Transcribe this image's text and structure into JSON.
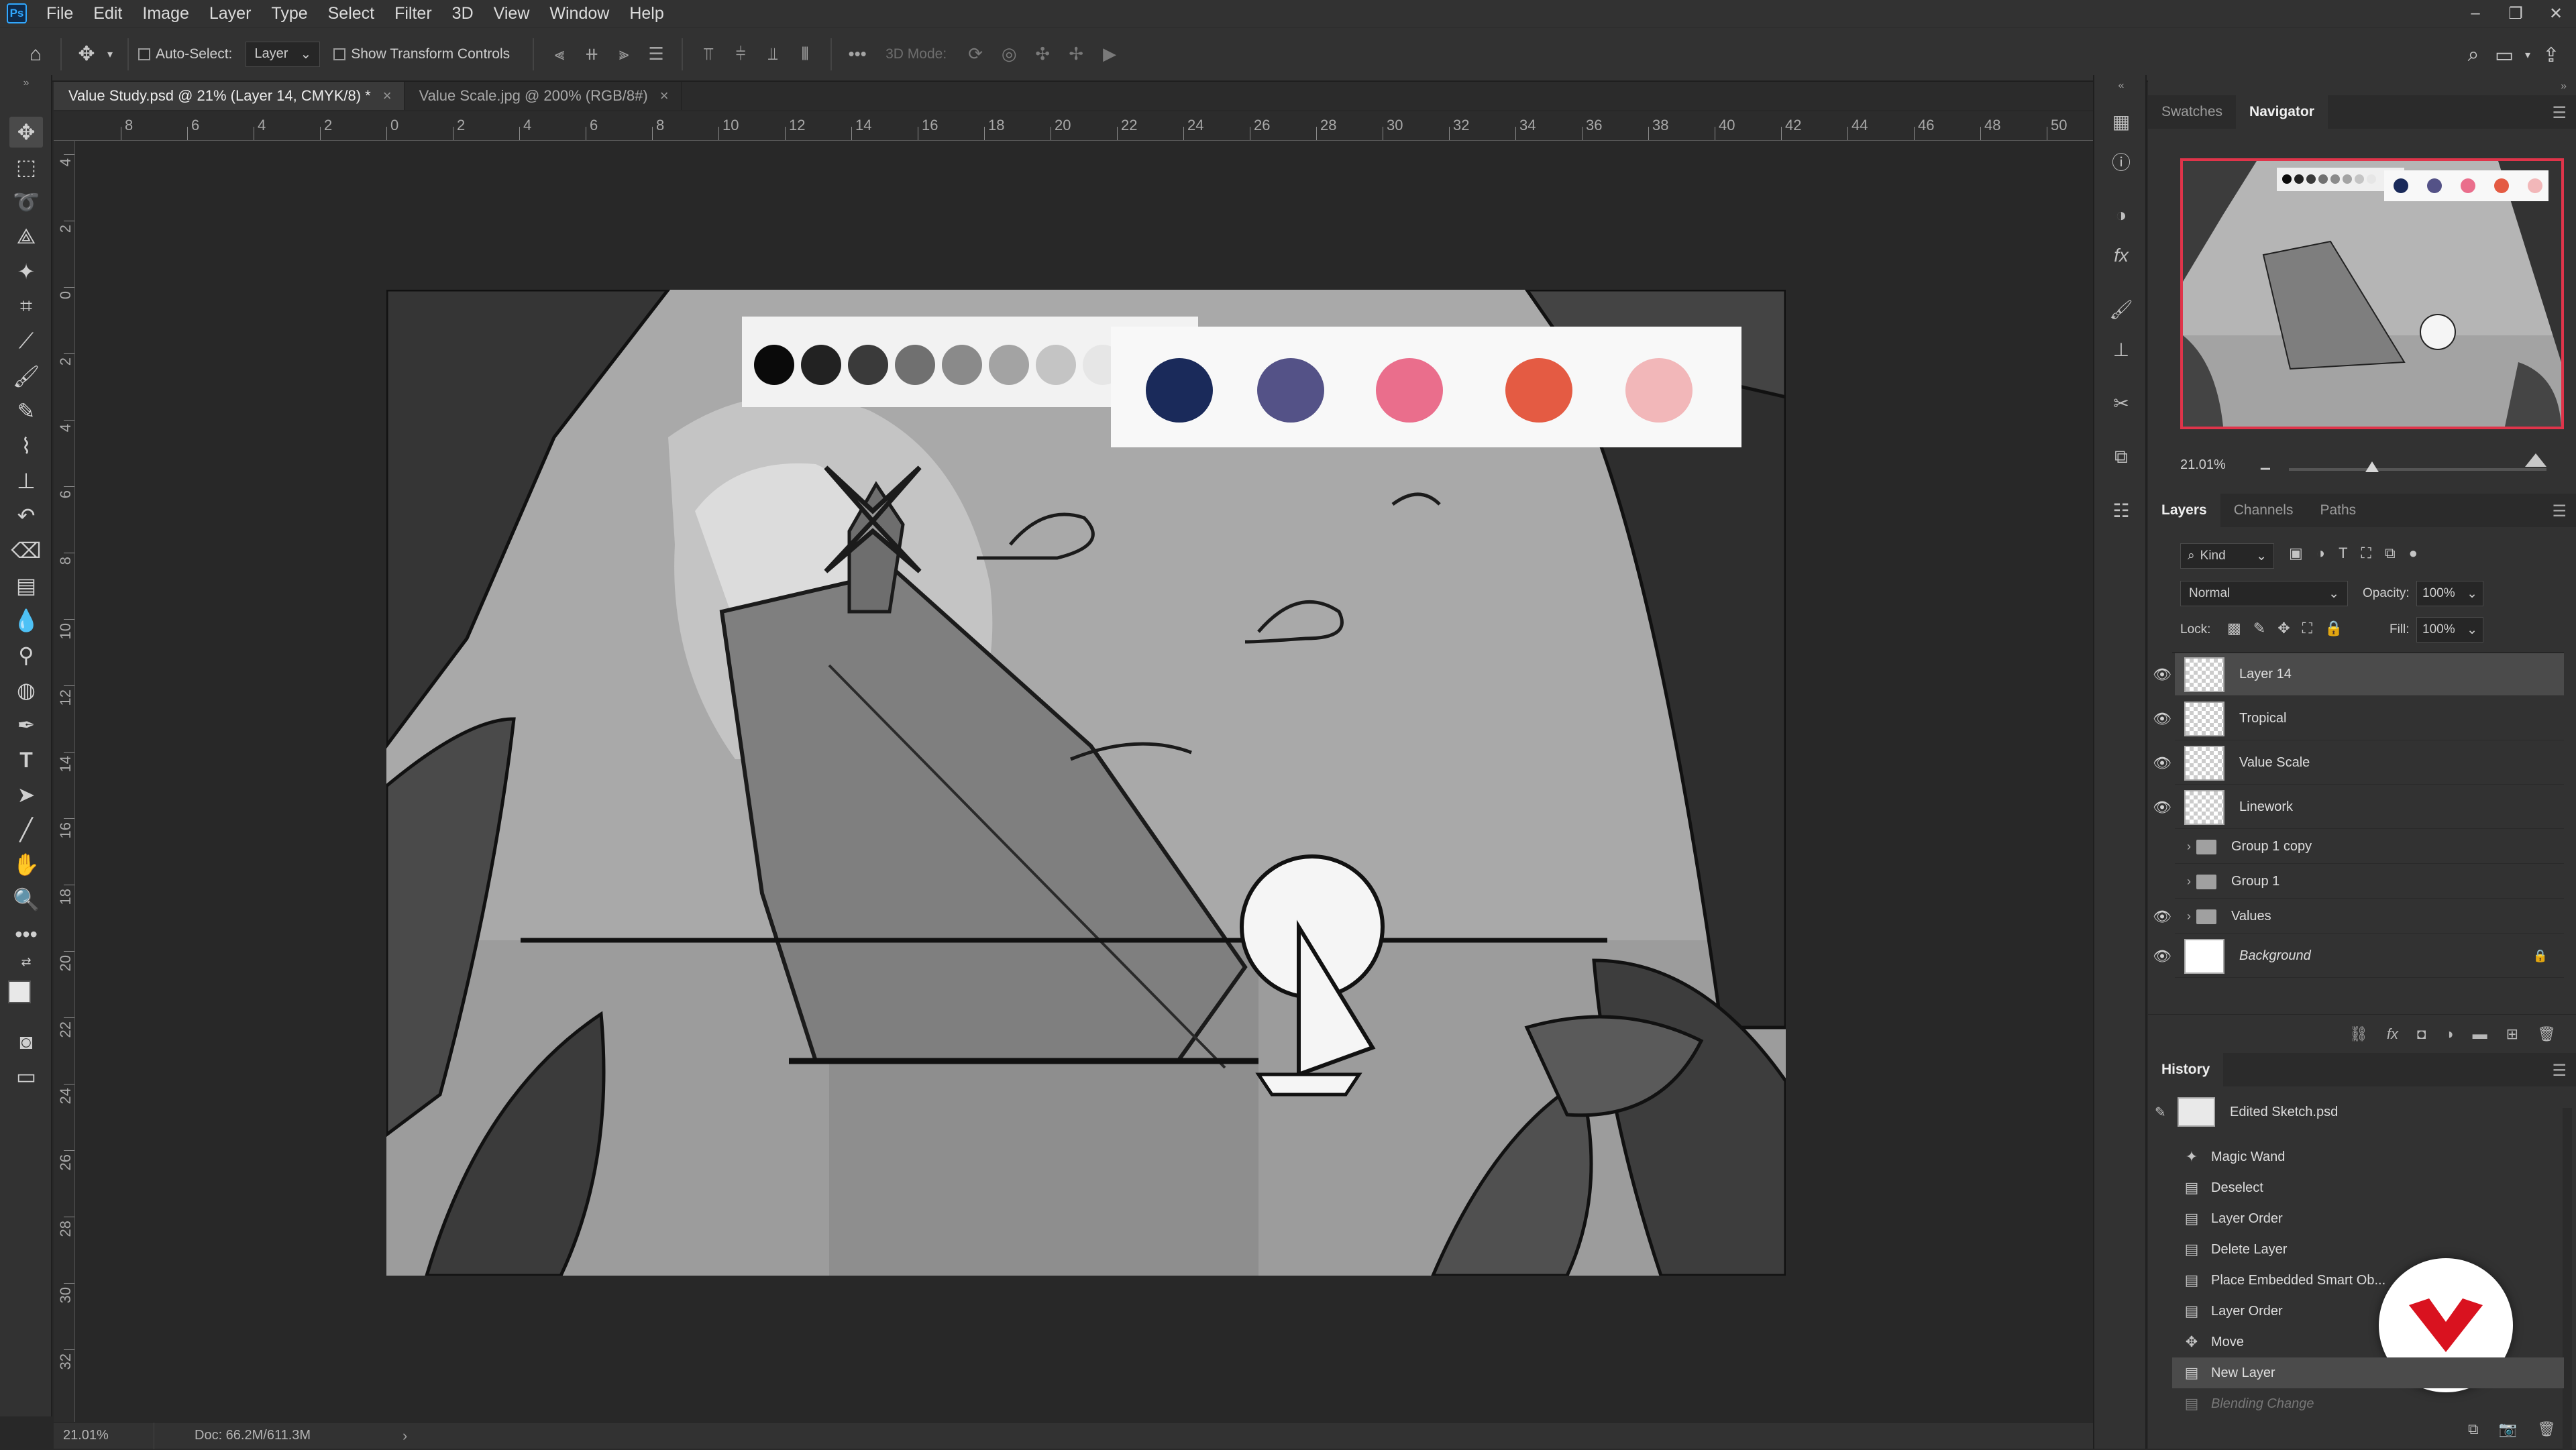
{
  "app": {
    "logo": "Ps"
  },
  "menu": [
    "File",
    "Edit",
    "Image",
    "Layer",
    "Type",
    "Select",
    "Filter",
    "3D",
    "View",
    "Window",
    "Help"
  ],
  "window_controls": {
    "minimize": "–",
    "restore": "❐",
    "close": "✕"
  },
  "options_bar": {
    "auto_select_label": "Auto-Select:",
    "auto_select_target": "Layer",
    "transform_controls_label": "Show Transform Controls",
    "mode_3d_label": "3D Mode:",
    "more": "•••"
  },
  "tabs": [
    {
      "label": "Value Study.psd @ 21% (Layer 14, CMYK/8) *",
      "active": true
    },
    {
      "label": "Value Scale.jpg @ 200% (RGB/8#)",
      "active": false
    }
  ],
  "tab_close": "×",
  "ruler": {
    "top_labels": [
      "8",
      "6",
      "4",
      "2",
      "0",
      "2",
      "4",
      "6",
      "8",
      "10",
      "12",
      "14",
      "16",
      "18",
      "20",
      "22",
      "24",
      "26",
      "28",
      "30",
      "32",
      "34",
      "36",
      "38",
      "40",
      "42",
      "44",
      "46",
      "48",
      "50"
    ],
    "left_labels": [
      "4",
      "2",
      "0",
      "2",
      "4",
      "6",
      "8",
      "10",
      "12",
      "14",
      "16",
      "18",
      "20",
      "22",
      "24",
      "26",
      "28",
      "30",
      "32"
    ]
  },
  "palette": {
    "values": [
      "#0a0a0a",
      "#222222",
      "#3a3a3a",
      "#707070",
      "#8a8a8a",
      "#a3a3a3",
      "#c4c4c4",
      "#e6e6e6"
    ],
    "colors": [
      "#1a2a5a",
      "#545287",
      "#ea6e8c",
      "#e45b43",
      "#f2b7b9"
    ]
  },
  "status": {
    "zoom": "21.01%",
    "doc": "Doc: 66.2M/611.3M",
    "arrow": "›"
  },
  "panels": {
    "top_tabs": [
      "Swatches",
      "Navigator"
    ],
    "navigator_zoom": "21.01%",
    "navigator_frame_color": "#e0344a",
    "layers_tabs": [
      "Layers",
      "Channels",
      "Paths"
    ],
    "filter_kind": "Kind",
    "blend_mode": "Normal",
    "opacity_label": "Opacity:",
    "opacity_value": "100%",
    "lock_label": "Lock:",
    "fill_label": "Fill:",
    "fill_value": "100%",
    "layers": [
      {
        "name": "Layer 14",
        "visible": true,
        "selected": true,
        "type": "layer"
      },
      {
        "name": "Tropical",
        "visible": true,
        "selected": false,
        "type": "smart"
      },
      {
        "name": "Value Scale",
        "visible": true,
        "selected": false,
        "type": "smart"
      },
      {
        "name": "Linework",
        "visible": true,
        "selected": false,
        "type": "layer"
      },
      {
        "name": "Group 1 copy",
        "visible": false,
        "selected": false,
        "type": "group"
      },
      {
        "name": "Group 1",
        "visible": false,
        "selected": false,
        "type": "group"
      },
      {
        "name": "Values",
        "visible": true,
        "selected": false,
        "type": "group"
      },
      {
        "name": "Background",
        "visible": true,
        "selected": false,
        "type": "background"
      }
    ],
    "history_title": "History",
    "history_snapshot": "Edited Sketch.psd",
    "history": [
      {
        "label": "Magic Wand",
        "icon": "magic-wand-icon"
      },
      {
        "label": "Deselect",
        "icon": "document-icon"
      },
      {
        "label": "Layer Order",
        "icon": "document-icon"
      },
      {
        "label": "Delete Layer",
        "icon": "document-icon"
      },
      {
        "label": "Place Embedded Smart Ob...",
        "icon": "document-icon"
      },
      {
        "label": "Layer Order",
        "icon": "document-icon"
      },
      {
        "label": "Move",
        "icon": "move-icon"
      },
      {
        "label": "New Layer",
        "icon": "document-icon",
        "selected": true
      },
      {
        "label": "Blending Change",
        "icon": "document-icon",
        "dim": true
      }
    ]
  },
  "badge_color": "#d9121f"
}
